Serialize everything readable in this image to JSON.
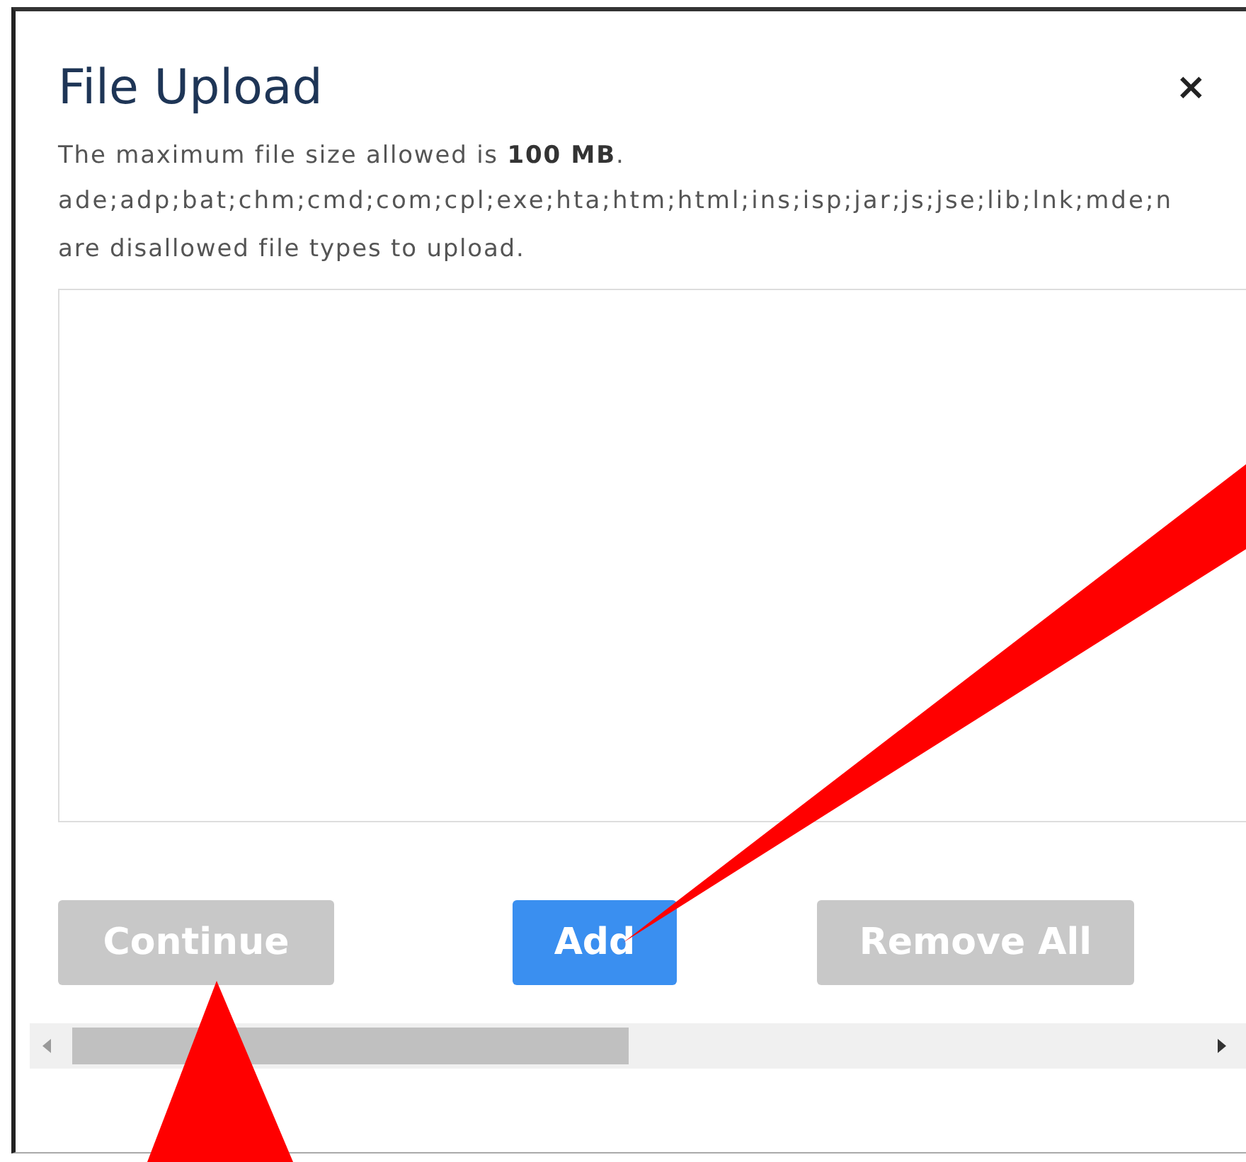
{
  "dialog": {
    "title": "File Upload",
    "close": "×",
    "size_note": "The maximum file size allowed is **100 MB**.",
    "file_types": "ade;adp;bat;chm;cmd;com;cpl;exe;hta;htm;html;ins;isp;jar;js;jse;lib;lnk;mde;n",
    "disallowed_note": "are disallowed file types to upload.",
    "buttons": [
      {
        "label": "Continue",
        "disabled": true
      },
      {
        "label": "Add",
        "disabled": false
      },
      {
        "label": "Remove All",
        "disabled": true
      }
    ]
  }
}
